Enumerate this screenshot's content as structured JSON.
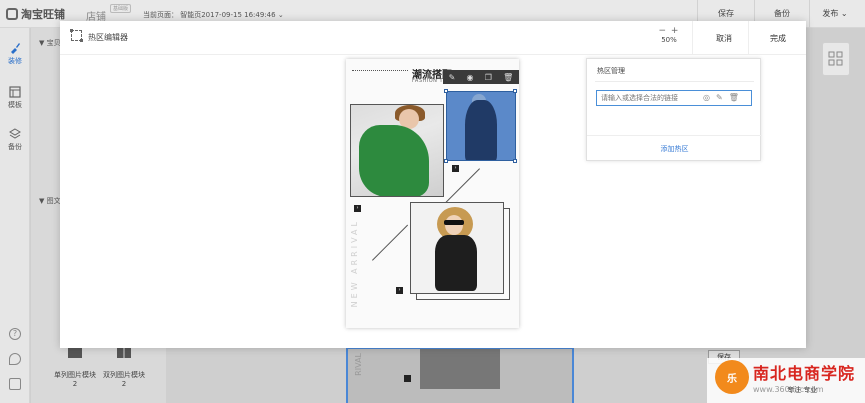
{
  "app": {
    "logo_text": "淘宝旺铺",
    "store_label": "店铺",
    "store_badge": "基础版",
    "current_page": "当前页面：  智能页2017-09-15 16:49:46"
  },
  "top_actions": {
    "save": "保存",
    "backup": "备份",
    "publish": "发布"
  },
  "sidebar": {
    "items": [
      {
        "label": "装修",
        "icon": "brush-icon",
        "active": true
      },
      {
        "label": "模板",
        "icon": "template-icon",
        "active": false
      },
      {
        "label": "备份",
        "icon": "layers-icon",
        "active": false
      }
    ],
    "bottom_icons": [
      "help-icon",
      "refresh-icon",
      "edit-icon"
    ]
  },
  "background_panel": {
    "section1": "宝贝",
    "section2": "图文",
    "modules": [
      {
        "label": "单列图片模块",
        "count": "2"
      },
      {
        "label": "双列图片模块",
        "count": "2"
      }
    ],
    "bg_save": "保存",
    "bg_canvas_text": "RIVAL",
    "bg_tags": "专注  专业"
  },
  "watermark": {
    "text": "南北电商学院",
    "logo": "乐",
    "url": "www.360doc.com"
  },
  "modal": {
    "title": "热区编辑器",
    "zoom_controls": "−  +",
    "zoom": "50%",
    "cancel": "取消",
    "done": "完成"
  },
  "canvas": {
    "title": "潮流搭配",
    "subtitle": "FASHION TREND",
    "vertical_text": "NEW ARRIVAL",
    "toolbar_icons": [
      "edit-icon",
      "eye-icon",
      "copy-icon",
      "delete-icon"
    ]
  },
  "hotspot_manager": {
    "title": "热区管理",
    "input_placeholder": "请输入或选择合法的链接",
    "add_button": "添加热区"
  },
  "colors": {
    "accent": "#3a7dd6",
    "selection": "#5b89c9",
    "watermark_red": "#d8261f"
  }
}
